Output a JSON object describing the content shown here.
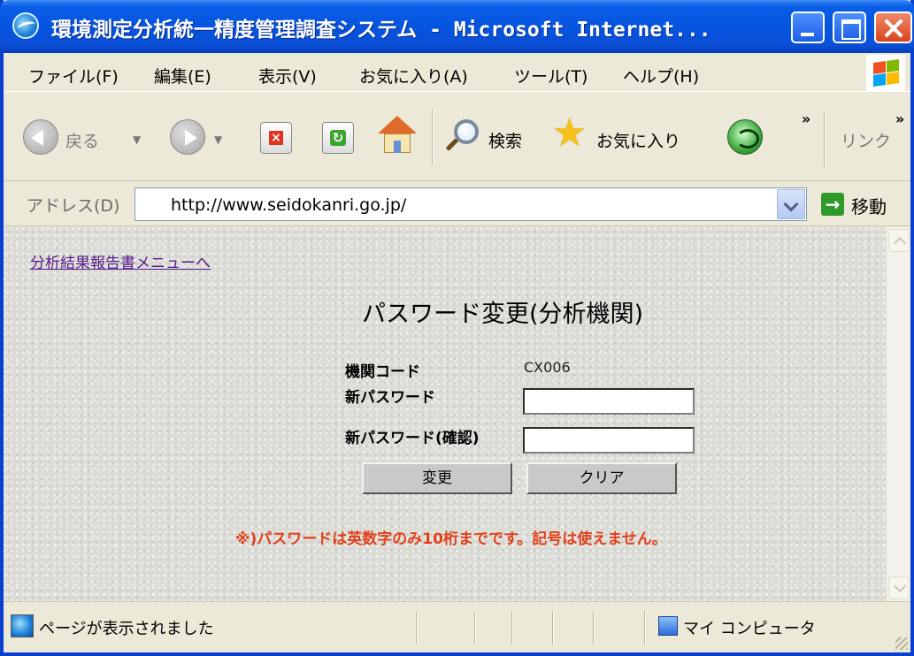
{
  "window": {
    "title": "環境測定分析統一精度管理調査システム - Microsoft Internet..."
  },
  "menubar": {
    "items": [
      "ファイル(F)",
      "編集(E)",
      "表示(V)",
      "お気に入り(A)",
      "ツール(T)",
      "ヘルプ(H)"
    ]
  },
  "toolbar": {
    "back_label": "戻る",
    "search_label": "検索",
    "favorites_label": "お気に入り",
    "links_label": "リンク"
  },
  "addressbar": {
    "label": "アドレス(D)",
    "url": "http://www.seidokanri.go.jp/",
    "go_label": "移動"
  },
  "page": {
    "menu_link": "分析結果報告書メニューへ",
    "title": "パスワード変更(分析機関)",
    "org_code_label": "機関コード",
    "org_code_value": "CX006",
    "new_password_label": "新パスワード",
    "confirm_password_label": "新パスワード(確認)",
    "new_password_value": "",
    "confirm_password_value": "",
    "change_button": "変更",
    "clear_button": "クリア",
    "note": "※)パスワードは英数字のみ10桁までです。記号は使えません。"
  },
  "statusbar": {
    "status_text": "ページが表示されました",
    "zone_text": "マイ コンピュータ"
  },
  "colors": {
    "titlebar": "#0554e0",
    "link": "#551a8b",
    "note": "#e2401a"
  }
}
